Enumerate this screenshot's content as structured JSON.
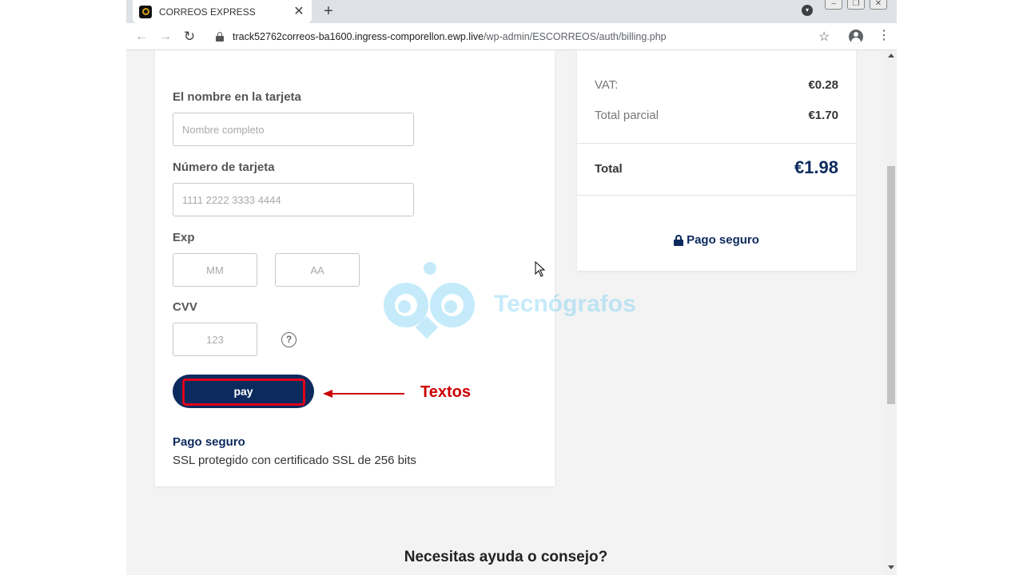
{
  "browser": {
    "tab_title": "CORREOS EXPRESS",
    "tab_close": "✕",
    "new_tab": "+",
    "url_host": "track52762correos-ba1600.ingress-comporellon.ewp.live",
    "url_path": "/wp-admin/ESCORREOS/auth/billing.php"
  },
  "form": {
    "name_label": "El nombre en la tarjeta",
    "name_placeholder": "Nombre completo",
    "card_label": "Número de tarjeta",
    "card_placeholder": "1111 2222 3333 4444",
    "exp_label": "Exp",
    "month_placeholder": "MM",
    "year_placeholder": "AA",
    "cvv_label": "CVV",
    "cvv_placeholder": "123",
    "help_glyph": "?",
    "pay_label": "pay",
    "secure_title": "Pago seguro",
    "secure_desc": "SSL protegido con certificado SSL de 256 bits"
  },
  "summary": {
    "vat_label": "VAT:",
    "vat_value": "€0.28",
    "subtotal_label": "Total parcial",
    "subtotal_value": "€1.70",
    "total_label": "Total",
    "total_value": "€1.98",
    "secure_label": "Pago seguro"
  },
  "footer": {
    "help_heading": "Necesitas ayuda o consejo?"
  },
  "overlay": {
    "annotation_label": "Textos",
    "watermark_text": "Tecnógrafos",
    "annotation_color": "#cc0000",
    "highlight_color": "#e0001b",
    "watermark_color": "#5bc8f2"
  },
  "colors": {
    "brand_navy": "#0c2a5e"
  }
}
